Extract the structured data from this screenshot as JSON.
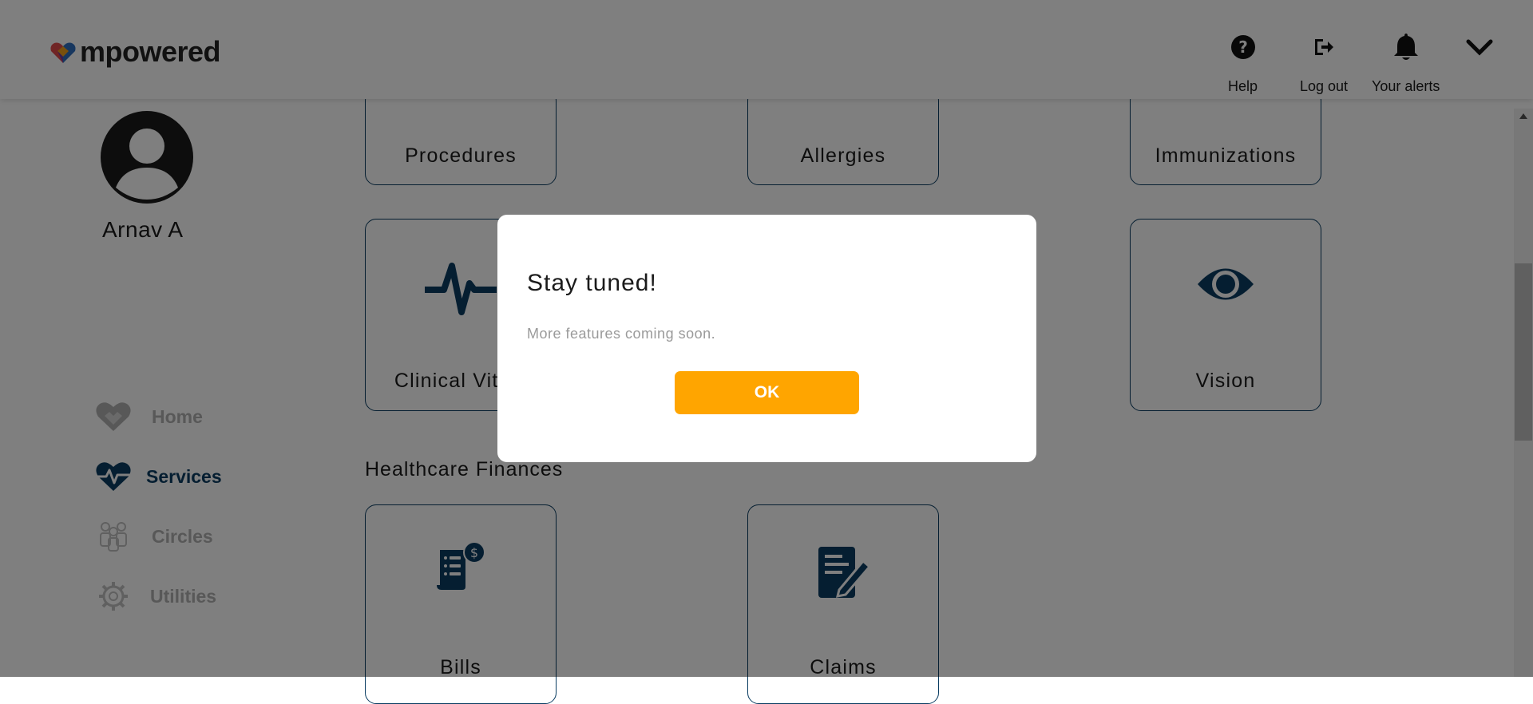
{
  "header": {
    "brand": "mpowered",
    "help_label": "Help",
    "logout_label": "Log out",
    "alerts_label": "Your alerts"
  },
  "profile": {
    "name": "Arnav A"
  },
  "nav": {
    "items": [
      {
        "label": "Home",
        "icon": "heart-hands-icon",
        "state": "muted"
      },
      {
        "label": "Services",
        "icon": "heart-pulse-icon",
        "state": "active"
      },
      {
        "label": "Circles",
        "icon": "people-icon",
        "state": "muted"
      },
      {
        "label": "Utilities",
        "icon": "gear-icon",
        "state": "muted"
      }
    ]
  },
  "services": {
    "cards": [
      {
        "label": "Procedures"
      },
      {
        "label": "Allergies"
      },
      {
        "label": "Immunizations"
      },
      {
        "label": "Clinical Vitals",
        "icon": "heartbeat-icon"
      },
      {
        "label": "Vision",
        "icon": "eye-icon"
      }
    ]
  },
  "finances": {
    "title": "Healthcare Finances",
    "cards": [
      {
        "label": "Bills",
        "icon": "bill-dollar-icon"
      },
      {
        "label": "Claims",
        "icon": "claim-document-icon"
      }
    ]
  },
  "modal": {
    "title": "Stay tuned!",
    "message": "More features coming soon.",
    "ok_label": "OK"
  },
  "colors": {
    "accent": "#ffa500",
    "primary": "#0a3d62",
    "overlay": "rgba(0,0,0,0.5)"
  }
}
